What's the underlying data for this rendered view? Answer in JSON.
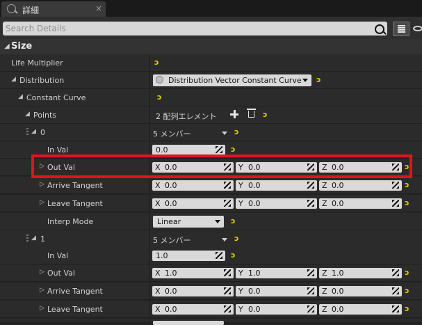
{
  "tab": {
    "title": "詳細",
    "close": "×"
  },
  "search": {
    "placeholder": "Search Details"
  },
  "section": {
    "title": "Size"
  },
  "rows": {
    "life_multiplier": {
      "label": "Life Multiplier"
    },
    "distribution": {
      "label": "Distribution",
      "value": "Distribution Vector Constant Curve"
    },
    "constant_curve": {
      "label": "Constant Curve"
    },
    "points": {
      "label": "Points",
      "value": "2 配列エレメント"
    },
    "p0": {
      "label": "0",
      "value": "5 メンバー",
      "in_val": {
        "label": "In Val",
        "value": "0.0"
      },
      "out_val": {
        "label": "Out Val",
        "x": "0.0",
        "y": "0.0",
        "z": "0.0"
      },
      "arrive_tangent": {
        "label": "Arrive Tangent",
        "x": "0.0",
        "y": "0.0",
        "z": "0.0"
      },
      "leave_tangent": {
        "label": "Leave Tangent",
        "x": "0.0",
        "y": "0.0",
        "z": "0.0"
      },
      "interp_mode": {
        "label": "Interp Mode",
        "value": "Linear"
      }
    },
    "p1": {
      "label": "1",
      "value": "5 メンバー",
      "in_val": {
        "label": "In Val",
        "value": "1.0"
      },
      "out_val": {
        "label": "Out Val",
        "x": "1.0",
        "y": "1.0",
        "z": "1.0"
      },
      "arrive_tangent": {
        "label": "Arrive Tangent",
        "x": "0.0",
        "y": "0.0",
        "z": "0.0"
      },
      "leave_tangent": {
        "label": "Leave Tangent",
        "x": "0.0",
        "y": "0.0",
        "z": "0.0"
      }
    }
  },
  "axes": {
    "x": "X",
    "y": "Y",
    "z": "Z"
  },
  "glyphs": {
    "reset": "ↄ",
    "expanded": "◢",
    "collapsed": "▷"
  },
  "colors": {
    "highlight": "#e0141c",
    "reset_arrow": "#e6d100"
  }
}
